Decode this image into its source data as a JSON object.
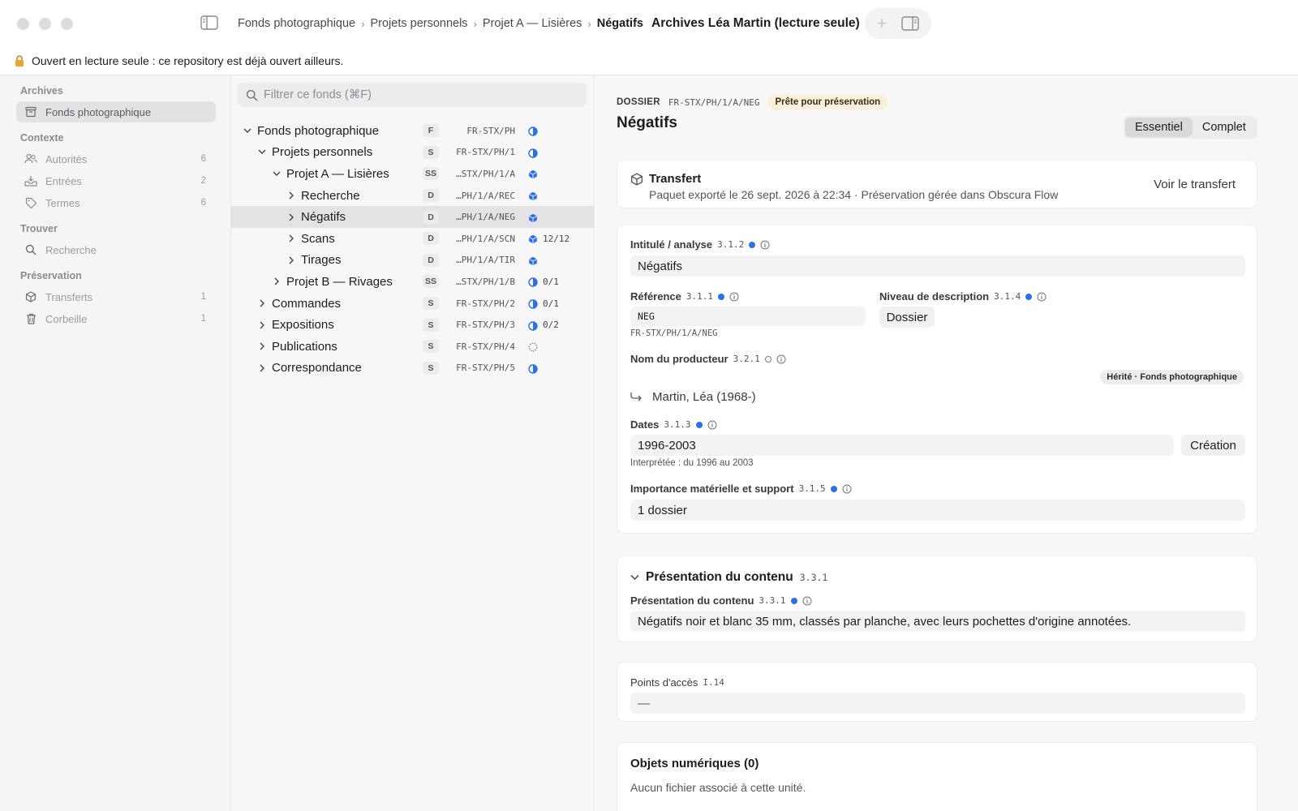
{
  "breadcrumb": [
    "Fonds photographique",
    "Projets personnels",
    "Projet A — Lisières",
    "Négatifs"
  ],
  "window_title": "Archives Léa Martin (lecture seule)",
  "banner": "Ouvert en lecture seule : ce repository est déjà ouvert ailleurs.",
  "sidebar": {
    "sections": [
      {
        "title": "Archives",
        "items": [
          {
            "label": "Fonds photographique",
            "icon": "archive-box-icon",
            "count": "",
            "active": true
          }
        ]
      },
      {
        "title": "Contexte",
        "items": [
          {
            "label": "Autorités",
            "icon": "people-icon",
            "count": "6"
          },
          {
            "label": "Entrées",
            "icon": "inbox-tray-icon",
            "count": "2"
          },
          {
            "label": "Termes",
            "icon": "tag-icon",
            "count": "6"
          }
        ]
      },
      {
        "title": "Trouver",
        "items": [
          {
            "label": "Recherche",
            "icon": "search-icon",
            "count": ""
          }
        ]
      },
      {
        "title": "Préservation",
        "items": [
          {
            "label": "Transferts",
            "icon": "package-icon",
            "count": "1"
          },
          {
            "label": "Corbeille",
            "icon": "trash-icon",
            "count": "1"
          }
        ]
      }
    ]
  },
  "filter_placeholder": "Filtrer ce fonds (⌘F)",
  "tree": [
    {
      "name": "Fonds photographique",
      "level": "F",
      "ref": "FR-STX/PH",
      "status": "half",
      "frac": "",
      "depth": 0,
      "expanded": true
    },
    {
      "name": "Projets personnels",
      "level": "S",
      "ref": "FR-STX/PH/1",
      "status": "half",
      "frac": "",
      "depth": 1,
      "expanded": true
    },
    {
      "name": "Projet A — Lisières",
      "level": "SS",
      "ref": "…STX/PH/1/A",
      "status": "cube",
      "frac": "",
      "depth": 2,
      "expanded": true
    },
    {
      "name": "Recherche",
      "level": "D",
      "ref": "…PH/1/A/REC",
      "status": "cube",
      "frac": "",
      "depth": 3,
      "expanded": false
    },
    {
      "name": "Négatifs",
      "level": "D",
      "ref": "…PH/1/A/NEG",
      "status": "cube",
      "frac": "",
      "depth": 3,
      "expanded": false,
      "selected": true
    },
    {
      "name": "Scans",
      "level": "D",
      "ref": "…PH/1/A/SCN",
      "status": "cube",
      "frac": "12/12",
      "depth": 3,
      "expanded": false
    },
    {
      "name": "Tirages",
      "level": "D",
      "ref": "…PH/1/A/TIR",
      "status": "cube",
      "frac": "",
      "depth": 3,
      "expanded": false
    },
    {
      "name": "Projet B — Rivages",
      "level": "SS",
      "ref": "…STX/PH/1/B",
      "status": "half",
      "frac": "0/1",
      "depth": 2,
      "expanded": false
    },
    {
      "name": "Commandes",
      "level": "S",
      "ref": "FR-STX/PH/2",
      "status": "half",
      "frac": "0/1",
      "depth": 1,
      "expanded": false
    },
    {
      "name": "Expositions",
      "level": "S",
      "ref": "FR-STX/PH/3",
      "status": "half",
      "frac": "0/2",
      "depth": 1,
      "expanded": false
    },
    {
      "name": "Publications",
      "level": "S",
      "ref": "FR-STX/PH/4",
      "status": "dashed",
      "frac": "",
      "depth": 1,
      "expanded": false
    },
    {
      "name": "Correspondance",
      "level": "S",
      "ref": "FR-STX/PH/5",
      "status": "half",
      "frac": "",
      "depth": 1,
      "expanded": false
    }
  ],
  "detail": {
    "kind": "DOSSIER",
    "ref": "FR-STX/PH/1/A/NEG",
    "badge": "Prête pour préservation",
    "title": "Négatifs",
    "tabs": {
      "essential": "Essentiel",
      "complete": "Complet"
    },
    "transfer": {
      "title": "Transfert",
      "subtitle": "Paquet exporté le 26 sept. 2026 à 22:34 · Préservation gérée dans Obscura Flow",
      "link": "Voir le transfert"
    },
    "fields": {
      "intitule": {
        "label": "Intitulé / analyse",
        "code": "3.1.2",
        "value": "Négatifs"
      },
      "reference": {
        "label": "Référence",
        "code": "3.1.1",
        "value": "NEG",
        "full": "FR-STX/PH/1/A/NEG"
      },
      "niveau": {
        "label": "Niveau de description",
        "code": "3.1.4",
        "value": "Dossier"
      },
      "producteur": {
        "label": "Nom du producteur",
        "code": "3.2.1",
        "inherited": "Hérité · Fonds photographique",
        "value": "Martin, Léa (1968-)"
      },
      "dates": {
        "label": "Dates",
        "code": "3.1.3",
        "value": "1996-2003",
        "type": "Création",
        "interpreted": "Interprétée : du 1996 au 2003"
      },
      "importance": {
        "label": "Importance matérielle et support",
        "code": "3.1.5",
        "value": "1 dossier"
      }
    },
    "contenu": {
      "section_title": "Présentation du contenu",
      "section_code": "3.3.1",
      "label": "Présentation du contenu",
      "code": "3.3.1",
      "value": "Négatifs noir et blanc 35 mm, classés par planche, avec leurs pochettes d'origine annotées."
    },
    "access": {
      "label": "Points d'accès",
      "code": "I.14",
      "value": "—"
    },
    "objects": {
      "title": "Objets numériques (0)",
      "empty": "Aucun fichier associé à cette unité."
    }
  },
  "colors": {
    "accent": "#2f6fe4",
    "badge_bg": "#fbefd9"
  }
}
